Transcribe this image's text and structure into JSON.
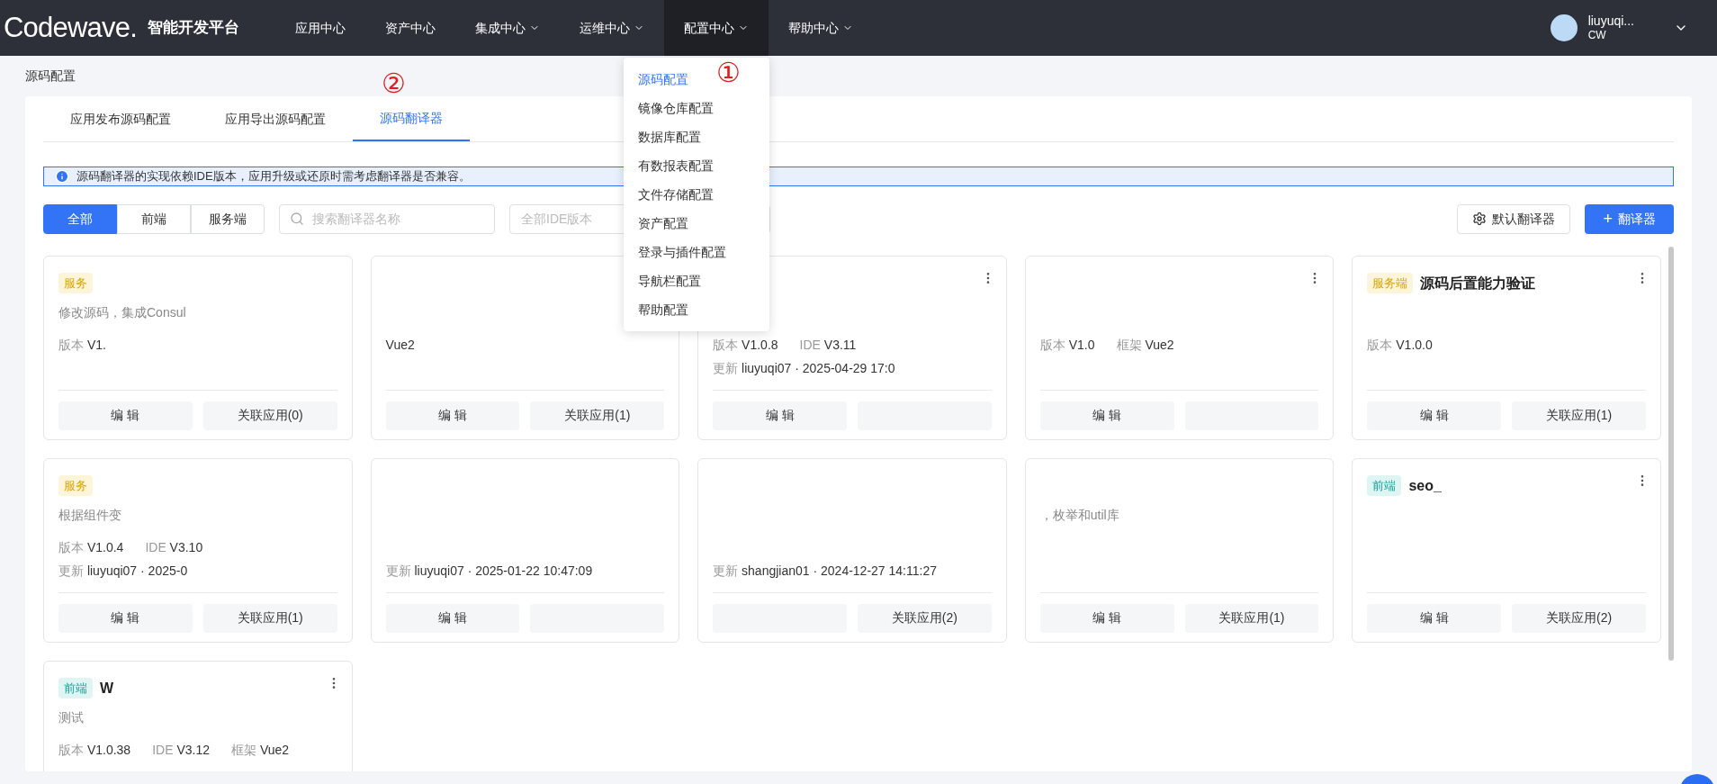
{
  "topbar": {
    "logo": "Codewave.",
    "platform": "智能开发平台",
    "nav": [
      {
        "label": "应用中心",
        "dropdown": false,
        "selected": false
      },
      {
        "label": "资产中心",
        "dropdown": false,
        "selected": false
      },
      {
        "label": "集成中心",
        "dropdown": true,
        "selected": false
      },
      {
        "label": "运维中心",
        "dropdown": true,
        "selected": false
      },
      {
        "label": "配置中心",
        "dropdown": true,
        "selected": true
      },
      {
        "label": "帮助中心",
        "dropdown": true,
        "selected": false
      }
    ],
    "user": {
      "name": "liuyuqi...",
      "org": "CW"
    }
  },
  "config_menu": [
    {
      "label": "源码配置",
      "selected": true
    },
    {
      "label": "镜像仓库配置",
      "selected": false
    },
    {
      "label": "数据库配置",
      "selected": false
    },
    {
      "label": "有数报表配置",
      "selected": false
    },
    {
      "label": "文件存储配置",
      "selected": false
    },
    {
      "label": "资产配置",
      "selected": false
    },
    {
      "label": "登录与插件配置",
      "selected": false
    },
    {
      "label": "导航栏配置",
      "selected": false
    },
    {
      "label": "帮助配置",
      "selected": false
    }
  ],
  "annotations": [
    "①",
    "②"
  ],
  "breadcrumb": "源码配置",
  "tabs": [
    {
      "label": "应用发布源码配置",
      "selected": false
    },
    {
      "label": "应用导出源码配置",
      "selected": false
    },
    {
      "label": "源码翻译器",
      "selected": true
    }
  ],
  "notice": "源码翻译器的实现依赖IDE版本，应用升级或还原时需考虑翻译器是否兼容。",
  "filters": [
    {
      "label": "全部",
      "selected": true
    },
    {
      "label": "前端",
      "selected": false
    },
    {
      "label": "服务端",
      "selected": false
    }
  ],
  "search": {
    "placeholder": "搜索翻译器名称"
  },
  "ide_select": {
    "placeholder": "全部IDE版本"
  },
  "actions": {
    "default": "默认翻译器",
    "add_icon": "+",
    "add": "翻译器"
  },
  "cards": [
    {
      "tag": {
        "label": "服务",
        "kind": "server"
      },
      "desc": "修改源码，集成Consul",
      "meta": [
        {
          "label": "版本",
          "value": "V1."
        }
      ],
      "edit": "编 辑",
      "link": "关联应用(0)",
      "more": false
    },
    {
      "meta": [
        {
          "value": "Vue2"
        }
      ],
      "edit": "编 辑",
      "link": "关联应用(1)",
      "more": false
    },
    {
      "meta": [
        {
          "label": "版本",
          "value": "V1.0.8"
        },
        {
          "label": "IDE",
          "value": "V3.11"
        }
      ],
      "updated": {
        "label": "更新",
        "value": "liuyuqi07 · 2025-04-29 17:0"
      },
      "edit": "编 辑",
      "more": true
    },
    {
      "meta": [
        {
          "label": "版本",
          "value": "V1.0"
        },
        {
          "label": "框架",
          "value": "Vue2"
        }
      ],
      "edit": "编 辑",
      "more": true
    },
    {
      "tag": {
        "label": "服务端",
        "kind": "server"
      },
      "title": "源码后置能力验证",
      "meta": [
        {
          "label": "版本",
          "value": "V1.0.0"
        }
      ],
      "edit": "编 辑",
      "link": "关联应用(1)",
      "more": true
    },
    {
      "tag": {
        "label": "服务",
        "kind": "server"
      },
      "desc": "根据组件变",
      "meta": [
        {
          "label": "版本",
          "value": "V1.0.4"
        },
        {
          "label": "IDE",
          "value": "V3.10"
        }
      ],
      "updated": {
        "label": "更新",
        "value": "liuyuqi07 · 2025-0"
      },
      "edit": "编 辑",
      "link": "关联应用(1)",
      "more": false
    },
    {
      "updated": {
        "label": "更新",
        "value": "liuyuqi07 · 2025-01-22 10:47:09"
      },
      "edit": "编 辑",
      "more": false
    },
    {
      "updated": {
        "label": "更新",
        "value": "shangjian01 · 2024-12-27 14:11:27"
      },
      "link": "关联应用(2)",
      "more": false
    },
    {
      "desc": "，枚举和util库",
      "edit": "编 辑",
      "link": "关联应用(1)",
      "more": false
    },
    {
      "tag": {
        "label": "前端",
        "kind": "frontend"
      },
      "title": "seo_",
      "edit": "编 辑",
      "link": "关联应用(2)",
      "more": true
    },
    {
      "tag": {
        "label": "前端",
        "kind": "frontend"
      },
      "title": "W",
      "desc": "测试",
      "meta": [
        {
          "label": "版本",
          "value": "V1.0.38"
        },
        {
          "label": "IDE",
          "value": "V3.12"
        },
        {
          "label": "框架",
          "value": "Vue2"
        }
      ],
      "more": true
    }
  ]
}
